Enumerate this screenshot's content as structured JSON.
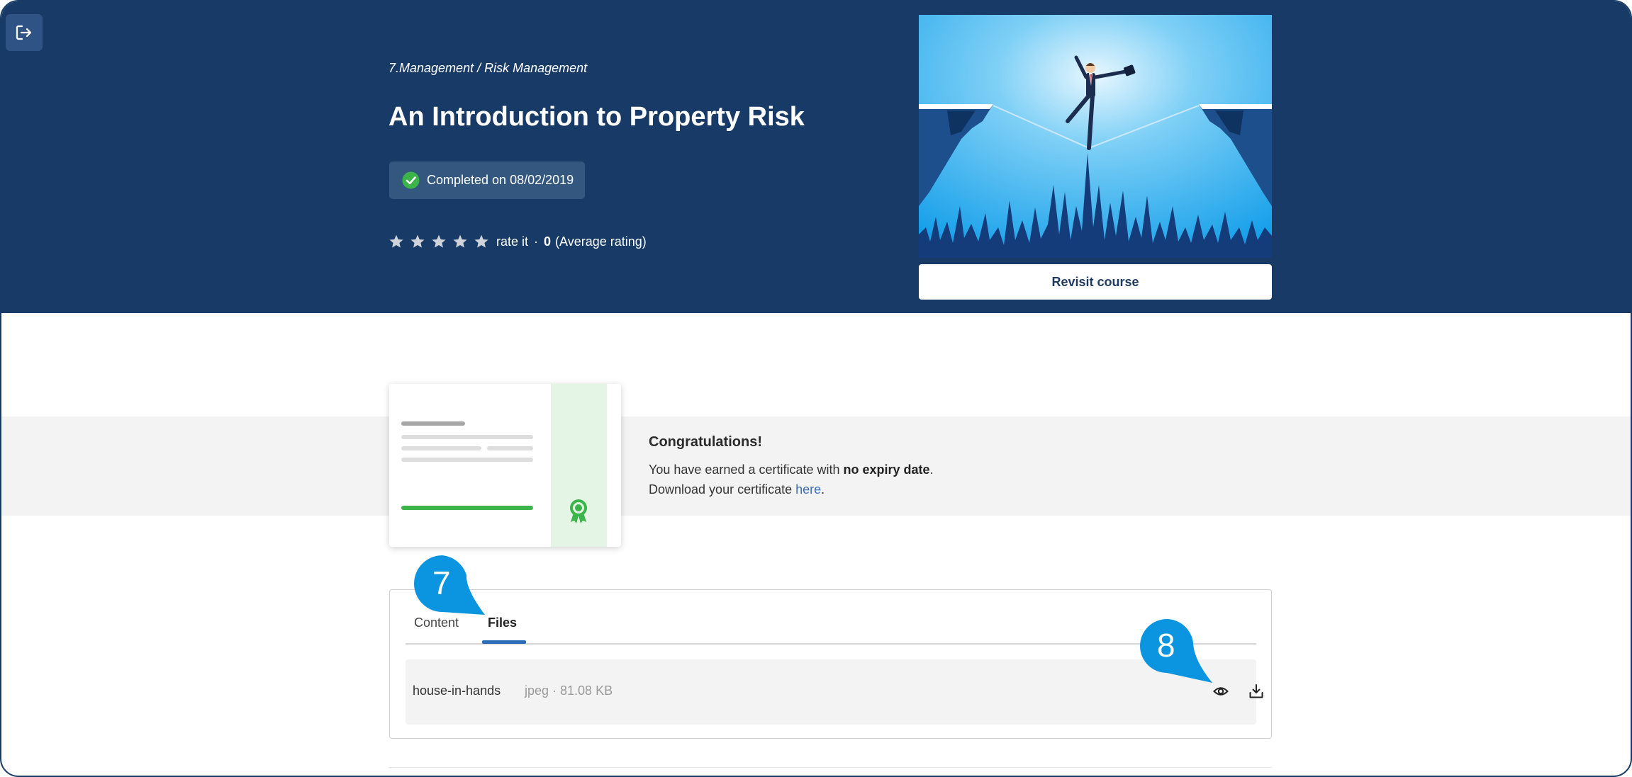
{
  "hero": {
    "breadcrumb": "7.Management / Risk Management",
    "title": "An Introduction to Property Risk",
    "completed_text": "Completed on 08/02/2019",
    "rating": {
      "stars": 5,
      "rate_label": "rate it",
      "separator": "·",
      "average_value": "0",
      "average_label": "(Average rating)"
    },
    "revisit_label": "Revisit course"
  },
  "certificate": {
    "title": "Congratulations!",
    "line1_prefix": "You have earned a certificate with ",
    "line1_bold": "no expiry date",
    "line1_suffix": ".",
    "line2_prefix": "Download your certificate ",
    "line2_link": "here",
    "line2_suffix": "."
  },
  "tabs": [
    {
      "label": "Content",
      "active": false
    },
    {
      "label": "Files",
      "active": true
    }
  ],
  "files": [
    {
      "name": "house-in-hands",
      "meta": "jpeg · 81.08 KB"
    }
  ],
  "callouts": [
    {
      "number": "7"
    },
    {
      "number": "8"
    }
  ],
  "icons": {
    "exit": "exit-icon",
    "check": "check-circle-icon",
    "star": "star-icon",
    "award": "award-ribbon-icon",
    "view": "eye-icon",
    "download": "download-icon"
  },
  "colors": {
    "hero_bg": "#183a66",
    "badge_bg": "#34577f",
    "success_green": "#3bb54a",
    "accent_blue": "#2c6cb7",
    "callout_blue": "#0b95e0",
    "link": "#3d6fb6"
  }
}
